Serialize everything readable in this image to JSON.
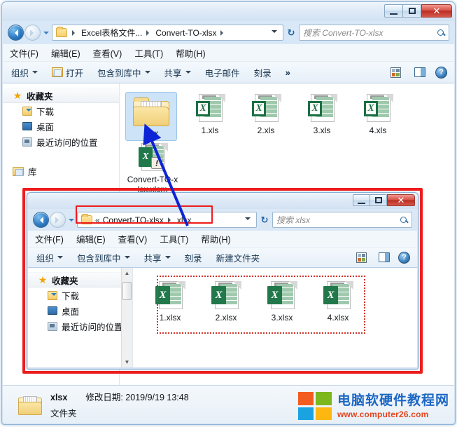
{
  "outer_window": {
    "window_controls": {
      "minimize": "—",
      "maximize": "▫",
      "close": "✕"
    },
    "address": {
      "crumbs": [
        "Excel表格文件...",
        "Convert-TO-xlsx"
      ],
      "search_placeholder": "搜索 Convert-TO-xlsx"
    },
    "menu": [
      "文件(F)",
      "编辑(E)",
      "查看(V)",
      "工具(T)",
      "帮助(H)"
    ],
    "commands": {
      "organize": "组织",
      "open": "打开",
      "include_in_library": "包含到库中",
      "share": "共享",
      "email": "电子邮件",
      "burn": "刻录",
      "more": "»"
    },
    "nav_pane": {
      "favorites": "收藏夹",
      "items": [
        "下载",
        "桌面",
        "最近访问的位置"
      ],
      "libraries": "库"
    },
    "files": [
      {
        "name": "xlsx",
        "type": "folder",
        "selected": true
      },
      {
        "name": "1.xls",
        "type": "xls",
        "selected": false
      },
      {
        "name": "2.xls",
        "type": "xls",
        "selected": false
      },
      {
        "name": "3.xls",
        "type": "xls",
        "selected": false
      },
      {
        "name": "4.xls",
        "type": "xls",
        "selected": false
      },
      {
        "name": "Convert-TO-xlsx.xlsm",
        "type": "xlsm",
        "selected": false
      }
    ],
    "details": {
      "name": "xlsx",
      "modified": "修改日期: 2019/9/19 13:48",
      "kind": "文件夹"
    }
  },
  "inner_window": {
    "window_controls": {
      "minimize": "—",
      "maximize": "▫",
      "close": "✕"
    },
    "address": {
      "overflow": "«",
      "crumbs": [
        "Convert-TO-xlsx",
        "xlsx"
      ],
      "search_placeholder": "搜索 xlsx"
    },
    "menu": [
      "文件(F)",
      "编辑(E)",
      "查看(V)",
      "工具(T)",
      "帮助(H)"
    ],
    "commands": {
      "organize": "组织",
      "include_in_library": "包含到库中",
      "share": "共享",
      "burn": "刻录",
      "new_folder": "新建文件夹"
    },
    "nav_pane": {
      "favorites": "收藏夹",
      "items": [
        "下载",
        "桌面",
        "最近访问的位置"
      ]
    },
    "files": [
      {
        "name": "1.xlsx",
        "type": "xlsx"
      },
      {
        "name": "2.xlsx",
        "type": "xlsx"
      },
      {
        "name": "3.xlsx",
        "type": "xlsx"
      },
      {
        "name": "4.xlsx",
        "type": "xlsx"
      }
    ]
  },
  "watermark": {
    "title": "电脑软硬件教程网",
    "url": "www.computer26.com"
  },
  "annotation_colors": {
    "red_box": "#ee1c1c",
    "blue_arrow": "#0d24d6",
    "dotted_selection": "#d0342c"
  }
}
